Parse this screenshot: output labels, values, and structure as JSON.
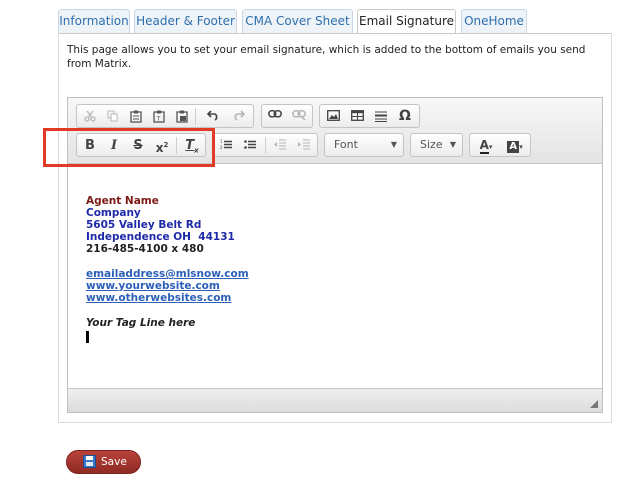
{
  "tabs": [
    {
      "label": "Information"
    },
    {
      "label": "Header & Footer"
    },
    {
      "label": "CMA Cover Sheet"
    },
    {
      "label": "Email Signature",
      "active": true
    },
    {
      "label": "OneHome"
    }
  ],
  "intro": "This page allows you to set your email signature, which is added to the bottom of emails you send from Matrix.",
  "toolbar": {
    "font_label": "Font",
    "size_label": "Size",
    "icons": [
      "cut-icon",
      "copy-icon",
      "paste-icon",
      "paste-text-icon",
      "paste-word-icon",
      "undo-icon",
      "redo-icon",
      "link-icon",
      "unlink-icon",
      "image-icon",
      "table-icon",
      "horizontal-rule-icon",
      "special-char-icon",
      "bold-icon",
      "italic-icon",
      "strikethrough-icon",
      "superscript-icon",
      "remove-format-icon",
      "numbered-list-icon",
      "bulleted-list-icon",
      "outdent-icon",
      "indent-icon",
      "text-color-icon",
      "background-color-icon"
    ]
  },
  "signature": {
    "name": "Agent Name",
    "company": "Company",
    "address1": "5605 Valley Belt Rd",
    "address2": "Independence OH  44131",
    "phone": "216-485-4100 x 480",
    "email": "emailaddress@mlsnow.com",
    "website1": "www.yourwebsite.com",
    "website2": "www.otherwebsites.com",
    "tagline": "Your Tag Line here"
  },
  "colors": {
    "name": "#7a1a14",
    "company": "#1f2aa8",
    "link": "#2b5fb8",
    "highlight": "#e23b25",
    "save_button": "#a8362f"
  },
  "save_label": "Save"
}
